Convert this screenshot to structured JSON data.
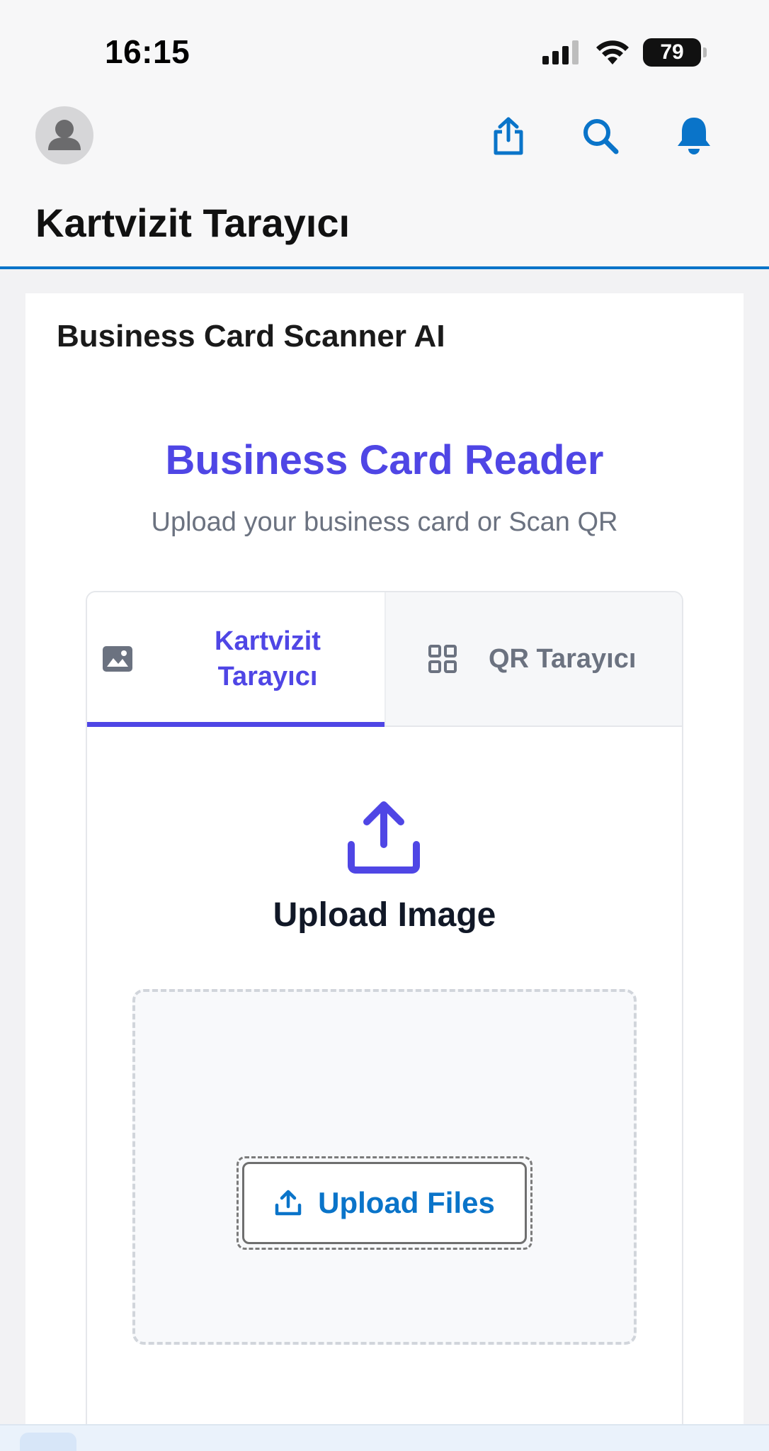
{
  "status_bar": {
    "time": "16:15",
    "battery": "79"
  },
  "nav": {
    "title": "Kartvizit Tarayıcı",
    "accent_color": "#0a74c9",
    "actions": [
      "share-icon",
      "search-icon",
      "bell-icon"
    ]
  },
  "card": {
    "title": "Business Card Scanner AI",
    "hero_title": "Business Card Reader",
    "hero_subtitle": "Upload your business card or Scan QR",
    "brand_color": "#4f46e5"
  },
  "tabs": [
    {
      "label": "Kartvizit\nTarayıcı",
      "icon": "image-icon",
      "active": true
    },
    {
      "label": "QR Tarayıcı",
      "icon": "grid-icon",
      "active": false
    }
  ],
  "upload": {
    "heading": "Upload Image",
    "button_label": "Upload Files"
  }
}
